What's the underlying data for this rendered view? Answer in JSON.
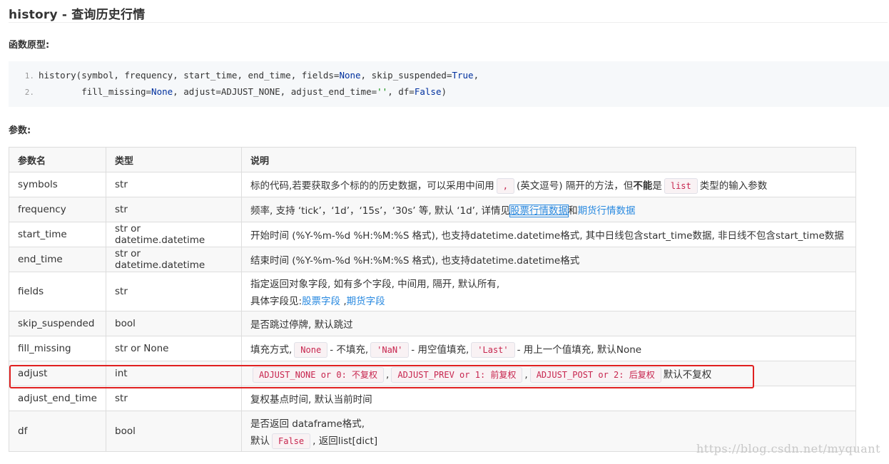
{
  "page": {
    "title": "history - 查询历史行情",
    "prototype_heading": "函数原型:",
    "params_heading": "参数:"
  },
  "code": {
    "lines": [
      {
        "num": "1.",
        "segments": [
          {
            "t": "history(symbol, frequency, start_time, end_time, fields=",
            "c": "plain"
          },
          {
            "t": "None",
            "c": "kw"
          },
          {
            "t": ", skip_suspended=",
            "c": "plain"
          },
          {
            "t": "True",
            "c": "kw"
          },
          {
            "t": ",",
            "c": "plain"
          }
        ]
      },
      {
        "num": "2.",
        "segments": [
          {
            "t": "        fill_missing=",
            "c": "plain"
          },
          {
            "t": "None",
            "c": "kw"
          },
          {
            "t": ", adjust=ADJUST_NONE, adjust_end_time=",
            "c": "plain"
          },
          {
            "t": "''",
            "c": "str"
          },
          {
            "t": ", df=",
            "c": "plain"
          },
          {
            "t": "False",
            "c": "kw"
          },
          {
            "t": ")",
            "c": "plain"
          }
        ]
      }
    ]
  },
  "table": {
    "headers": [
      "参数名",
      "类型",
      "说明"
    ],
    "rows": [
      {
        "name": "symbols",
        "type": "str",
        "zebra": false,
        "size": "normal",
        "desc": [
          {
            "k": "text",
            "v": "标的代码,若要获取多个标的的历史数据，可以采用中间用"
          },
          {
            "k": "code",
            "v": ","
          },
          {
            "k": "text",
            "v": "(英文逗号) 隔开的方法，但"
          },
          {
            "k": "bold",
            "v": "不能"
          },
          {
            "k": "text",
            "v": "是"
          },
          {
            "k": "code",
            "v": "list"
          },
          {
            "k": "text",
            "v": "类型的输入参数"
          }
        ]
      },
      {
        "name": "frequency",
        "type": "str",
        "zebra": true,
        "size": "normal",
        "desc": [
          {
            "k": "text",
            "v": "频率, 支持 ‘tick’，‘1d’，‘15s’，‘30s’ 等, 默认 ‘1d’, 详情见"
          },
          {
            "k": "linkboxed",
            "v": "股票行情数据"
          },
          {
            "k": "text",
            "v": "和"
          },
          {
            "k": "link",
            "v": "期货行情数据"
          }
        ]
      },
      {
        "name": "start_time",
        "type": "str or datetime.datetime",
        "zebra": false,
        "size": "normal",
        "desc": [
          {
            "k": "text",
            "v": "开始时间 (%Y-%m-%d %H:%M:%S 格式), 也支持datetime.datetime格式, 其中日线包含start_time数据, 非日线不包含start_time数据"
          }
        ]
      },
      {
        "name": "end_time",
        "type": "str or datetime.datetime",
        "zebra": true,
        "size": "normal",
        "desc": [
          {
            "k": "text",
            "v": "结束时间 (%Y-%m-%d %H:%M:%S 格式), 也支持datetime.datetime格式"
          }
        ]
      },
      {
        "name": "fields",
        "type": "str",
        "zebra": false,
        "size": "tall",
        "desc": [
          {
            "k": "text",
            "v": "指定返回对象字段, 如有多个字段, 中间用, 隔开, 默认所有,"
          },
          {
            "k": "br"
          },
          {
            "k": "text",
            "v": "具体字段见:"
          },
          {
            "k": "link",
            "v": "股票字段"
          },
          {
            "k": "text",
            "v": " ,"
          },
          {
            "k": "link",
            "v": "期货字段"
          }
        ]
      },
      {
        "name": "skip_suspended",
        "type": "bool",
        "zebra": true,
        "size": "normal",
        "desc": [
          {
            "k": "text",
            "v": "是否跳过停牌, 默认跳过"
          }
        ]
      },
      {
        "name": "fill_missing",
        "type": "str or None",
        "zebra": false,
        "size": "normal",
        "desc": [
          {
            "k": "text",
            "v": "填充方式,"
          },
          {
            "k": "code",
            "v": "None"
          },
          {
            "k": "text",
            "v": "- 不填充,"
          },
          {
            "k": "code",
            "v": "'NaN'"
          },
          {
            "k": "text",
            "v": "- 用空值填充,"
          },
          {
            "k": "code",
            "v": "'Last'"
          },
          {
            "k": "text",
            "v": "- 用上一个值填充, 默认None"
          }
        ]
      },
      {
        "name": "adjust",
        "type": "int",
        "zebra": true,
        "size": "normal",
        "desc": [
          {
            "k": "code",
            "v": "ADJUST_NONE or 0: 不复权"
          },
          {
            "k": "text",
            "v": ","
          },
          {
            "k": "code",
            "v": "ADJUST_PREV or 1: 前复权"
          },
          {
            "k": "text",
            "v": ","
          },
          {
            "k": "code",
            "v": "ADJUST_POST or 2: 后复权"
          },
          {
            "k": "text",
            "v": "默认不复权"
          }
        ]
      },
      {
        "name": "adjust_end_time",
        "type": "str",
        "zebra": false,
        "size": "normal",
        "desc": [
          {
            "k": "text",
            "v": "复权基点时间, 默认当前时间"
          }
        ]
      },
      {
        "name": "df",
        "type": "bool",
        "zebra": true,
        "size": "mid",
        "desc": [
          {
            "k": "text",
            "v": "是否返回 dataframe格式,"
          },
          {
            "k": "br"
          },
          {
            "k": "text",
            "v": "默认"
          },
          {
            "k": "code",
            "v": "False"
          },
          {
            "k": "text",
            "v": ", 返回list[dict]"
          }
        ]
      }
    ]
  },
  "watermark": "https://blog.csdn.net/myquant"
}
